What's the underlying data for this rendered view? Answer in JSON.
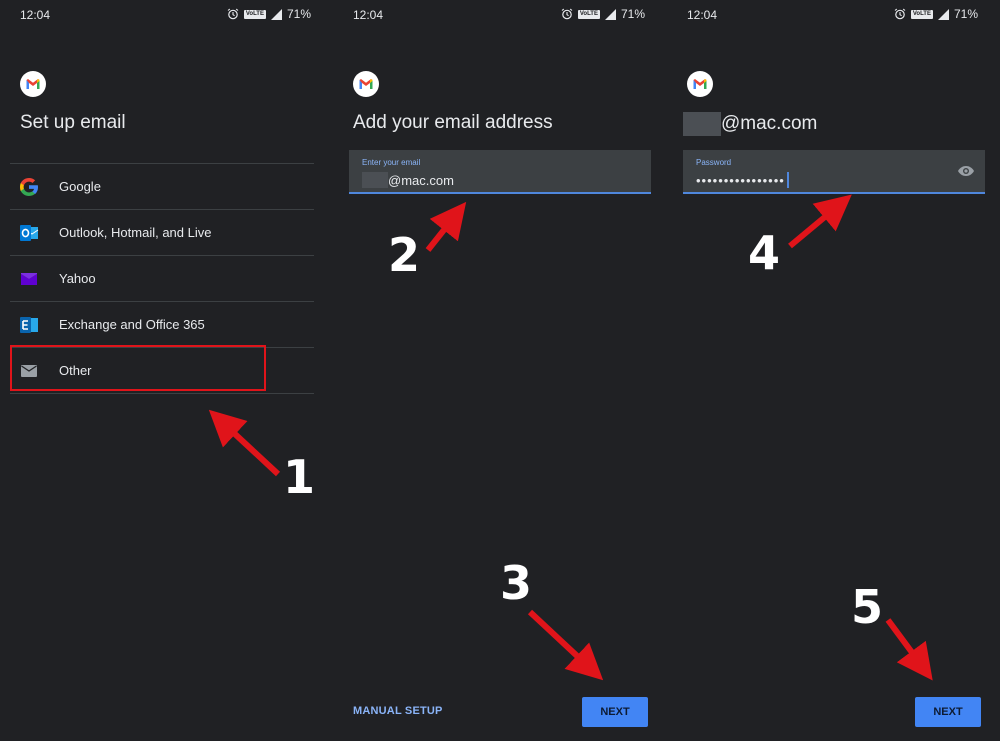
{
  "status_bar": {
    "time": "12:04",
    "network_badge": "VoLTE",
    "battery": "71%",
    "icons": [
      "alarm-icon",
      "signal-icon"
    ]
  },
  "panel1": {
    "title": "Set up email",
    "providers": [
      {
        "label": "Google",
        "icon": "google-icon"
      },
      {
        "label": "Outlook, Hotmail, and Live",
        "icon": "outlook-icon"
      },
      {
        "label": "Yahoo",
        "icon": "yahoo-icon"
      },
      {
        "label": "Exchange and Office 365",
        "icon": "exchange-icon"
      },
      {
        "label": "Other",
        "icon": "mail-icon"
      }
    ]
  },
  "panel2": {
    "title": "Add your email address",
    "email_label": "Enter your email",
    "email_value": "@mac.com",
    "manual_setup": "MANUAL SETUP",
    "next": "NEXT"
  },
  "panel3": {
    "email_heading": "@mac.com",
    "password_label": "Password",
    "password_value": "••••••••••••••••",
    "next": "NEXT"
  },
  "annotations": {
    "steps": [
      "1",
      "2",
      "3",
      "4",
      "5"
    ],
    "accent_color": "#e0141a"
  },
  "colors": {
    "background": "#202124",
    "accent_blue": "#4285f4",
    "link_blue": "#8ab4f8"
  }
}
